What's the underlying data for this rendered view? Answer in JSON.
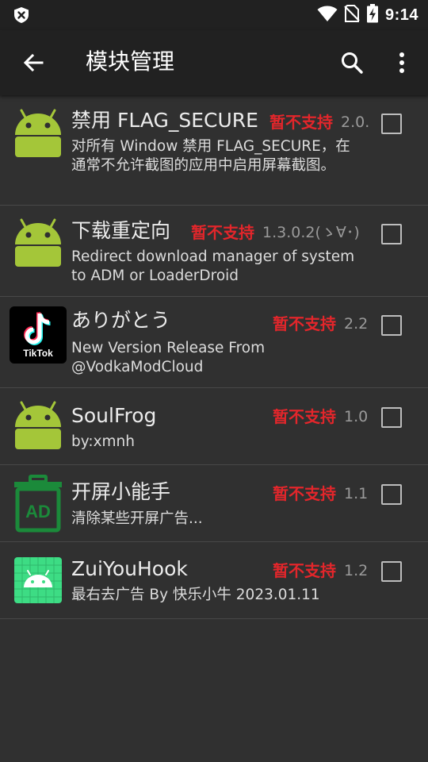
{
  "status_bar": {
    "time": "9:14",
    "icons": [
      "app-notification-icon",
      "wifi-icon",
      "no-sim-icon",
      "battery-charging-icon"
    ]
  },
  "app_bar": {
    "title": "模块管理",
    "back_icon": "arrow-back-icon",
    "search_icon": "search-icon",
    "more_icon": "more-vert-icon"
  },
  "modules": [
    {
      "icon": "android-robot-icon",
      "title": "禁用 FLAG_SECURE",
      "status": "暂不支持",
      "version": "2.0.",
      "description": "对所有 Window 禁用 FLAG_SECURE，在通常不允许截图的应用中启用屏幕截图。",
      "checked": false
    },
    {
      "icon": "android-robot-icon",
      "title": "下载重定向",
      "status": "暂不支持",
      "version": "1.3.0.2(ゝ∀･)",
      "description": "Redirect download manager of system to ADM or LoaderDroid",
      "checked": false
    },
    {
      "icon": "tiktok-logo-icon",
      "icon_label": "TikTok",
      "title": "ありがとう",
      "status": "暂不支持",
      "version": "2.2",
      "description": "New Version Release From @VodkaModCloud",
      "checked": false
    },
    {
      "icon": "android-robot-icon",
      "title": "SoulFrog",
      "status": "暂不支持",
      "version": "1.0",
      "description": "by:xmnh",
      "checked": false
    },
    {
      "icon": "ad-trash-icon",
      "title": "开屏小能手",
      "status": "暂不支持",
      "version": "1.1",
      "description": "清除某些开屏广告...",
      "checked": false
    },
    {
      "icon": "android-grid-icon",
      "title": "ZuiYouHook",
      "status": "暂不支持",
      "version": "1.2",
      "description": "最右去广告 By 快乐小牛 2023.01.11",
      "checked": false
    }
  ],
  "colors": {
    "background": "#303030",
    "app_bar": "#212121",
    "status_red": "#e3262b",
    "android_green": "#a4c639",
    "ad_green": "#1b8a3a",
    "grid_green": "#3ddc84"
  }
}
